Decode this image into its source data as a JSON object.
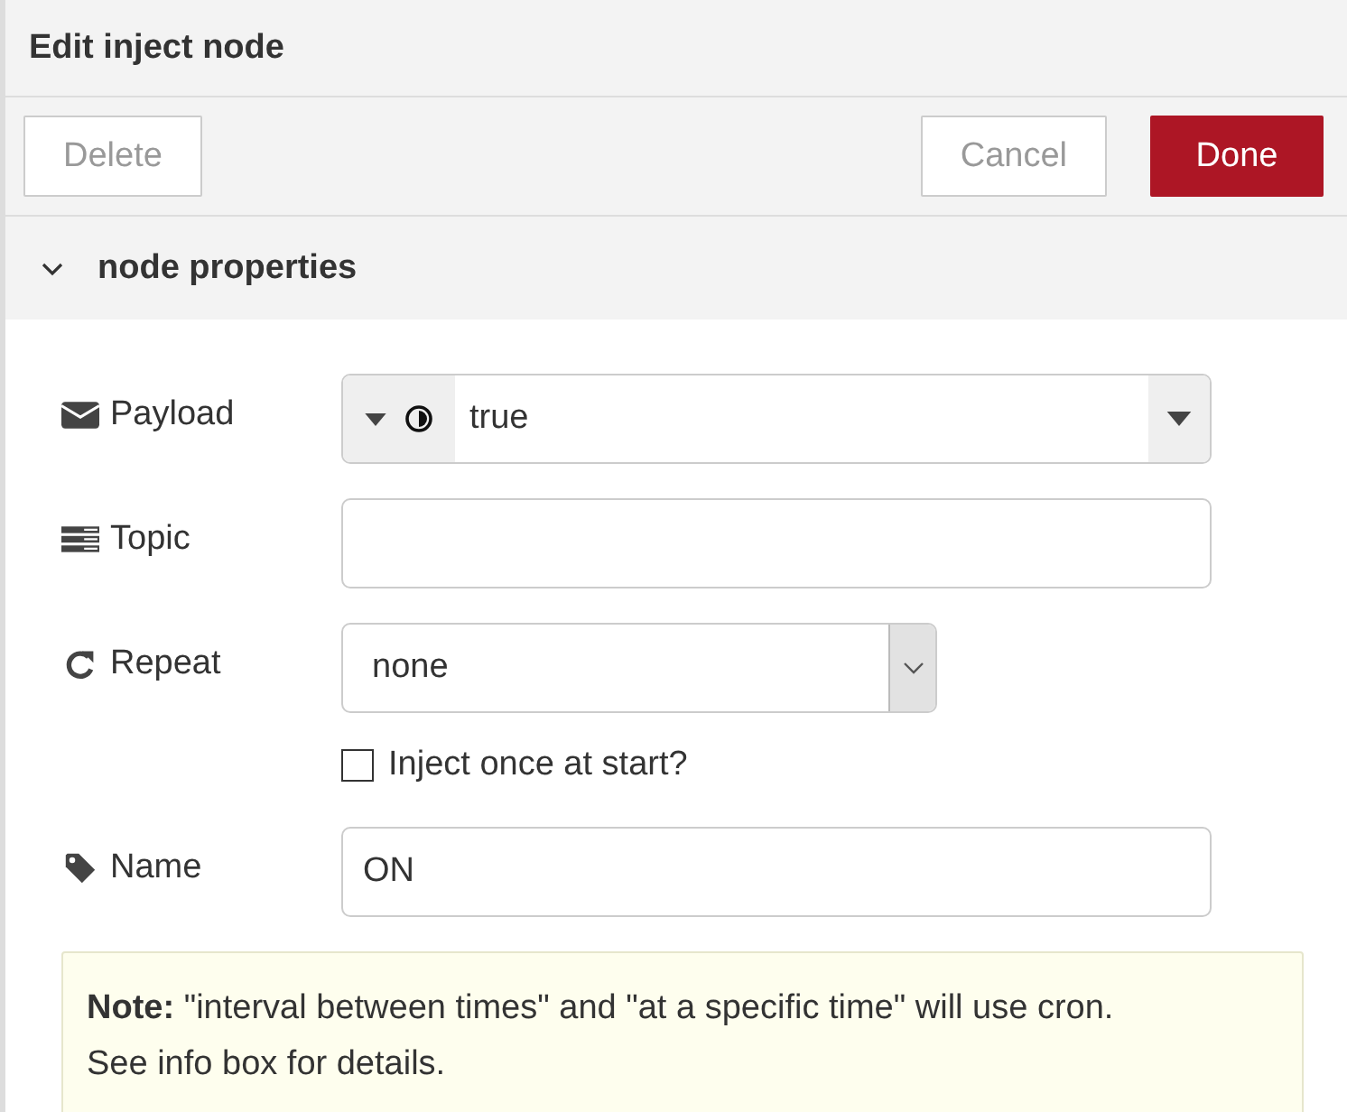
{
  "window": {
    "title": "Edit inject node"
  },
  "toolbar": {
    "buttons": [
      {
        "label": "Delete",
        "kind": "secondary"
      },
      {
        "label": "Cancel",
        "kind": "secondary"
      },
      {
        "label": "Done",
        "kind": "primary"
      }
    ]
  },
  "section": {
    "title": "node properties",
    "expanded": true
  },
  "rows": [
    {
      "kind": "typed",
      "label": "Payload",
      "value": "true"
    },
    {
      "kind": "text",
      "label": "Topic"
    },
    {
      "kind": "select",
      "label": "Repeat",
      "value": "none"
    },
    {
      "kind": "checkbox",
      "label": "Inject once at start?",
      "checked": false
    },
    {
      "kind": "text",
      "label": "Name",
      "value": "ON"
    }
  ],
  "note": {
    "lines": [
      "**Note:** \"interval between times\" and \"at a specific time\" will use cron.",
      "See info box for details."
    ]
  }
}
